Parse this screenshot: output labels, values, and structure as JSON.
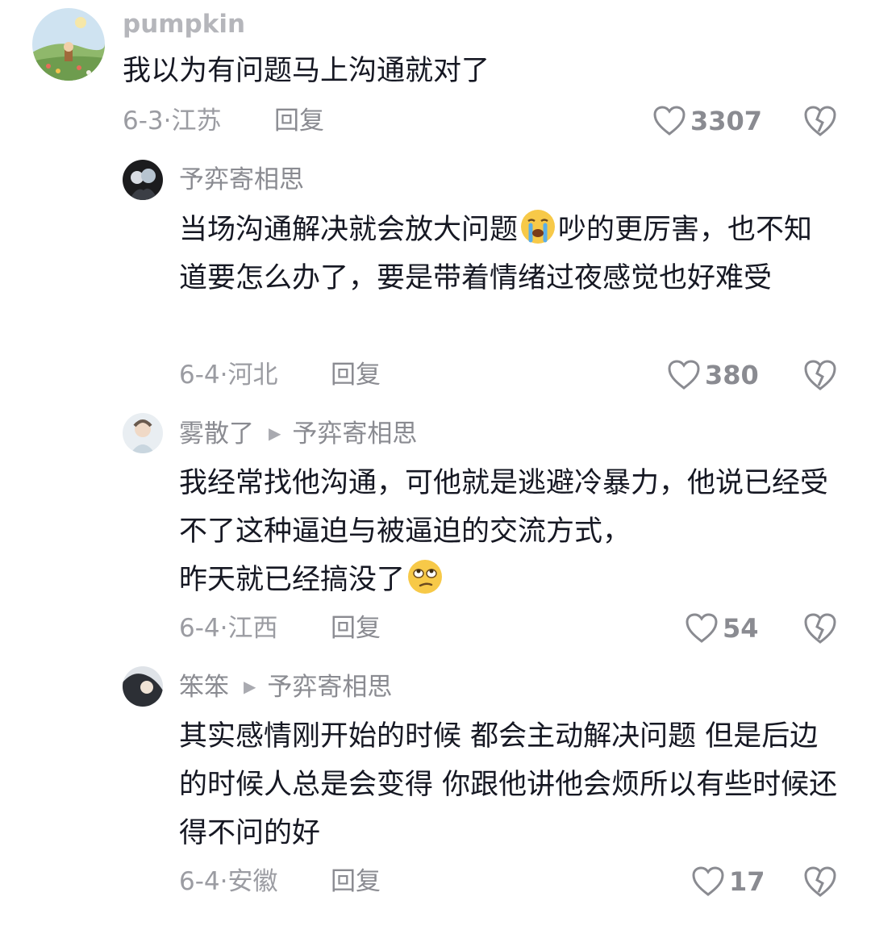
{
  "comments": [
    {
      "username": "pumpkin",
      "text": "我以为有问题马上沟通就对了",
      "date": "6-3",
      "location": "江苏",
      "reply_label": "回复",
      "likes": "3307"
    },
    {
      "username": "予弈寄相思",
      "text_a": "当场沟通解决就会放大问题",
      "emoji": "loudly-crying-face",
      "text_b": "吵的更厉害，也不知道要怎么办了，要是带着情绪过夜感觉也好难受",
      "date": "6-4",
      "location": "河北",
      "reply_label": "回复",
      "likes": "380"
    },
    {
      "username": "雾散了",
      "reply_to": "予弈寄相思",
      "text_a": "我经常找他沟通，可他就是逃避冷暴力，他说已经受不了这种逼迫与被逼迫的交流方式，\n昨天就已经搞没了",
      "emoji": "face-with-rolling-eyes",
      "date": "6-4",
      "location": "江西",
      "reply_label": "回复",
      "likes": "54"
    },
    {
      "username": "笨笨",
      "reply_to": "予弈寄相思",
      "text": "其实感情刚开始的时候 都会主动解决问题 但是后边的时候人总是会变得 你跟他讲他会烦所以有些时候还得不问的好",
      "date": "6-4",
      "location": "安徽",
      "reply_label": "回复",
      "likes": "17"
    }
  ],
  "icons": {
    "like": "heart-outline-icon",
    "dislike": "broken-heart-icon",
    "reply_arrow": "play-triangle-icon"
  },
  "colors": {
    "text_primary": "#161823",
    "text_secondary": "#8a8b91"
  }
}
